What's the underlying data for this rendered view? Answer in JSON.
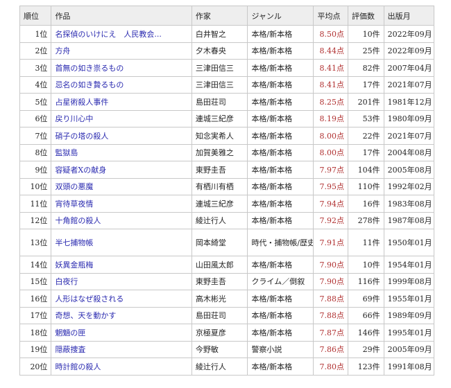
{
  "headers": {
    "rank": "順位",
    "title": "作品",
    "author": "作家",
    "genre": "ジャンル",
    "score": "平均点",
    "count": "評価数",
    "published": "出版月"
  },
  "rows": [
    {
      "rank": "1位",
      "title": "名探偵のいけにえ　人民教会...",
      "author": "白井智之",
      "genre": "本格/新本格",
      "score": "8.50点",
      "count": "10件",
      "published": "2022年09月"
    },
    {
      "rank": "2位",
      "title": "方舟",
      "author": "夕木春央",
      "genre": "本格/新本格",
      "score": "8.44点",
      "count": "25件",
      "published": "2022年09月"
    },
    {
      "rank": "3位",
      "title": "首無の如き祟るもの",
      "author": "三津田信三",
      "genre": "本格/新本格",
      "score": "8.41点",
      "count": "82件",
      "published": "2007年04月"
    },
    {
      "rank": "4位",
      "title": "忌名の如き贄るもの",
      "author": "三津田信三",
      "genre": "本格/新本格",
      "score": "8.41点",
      "count": "17件",
      "published": "2021年07月"
    },
    {
      "rank": "5位",
      "title": "占星術殺人事件",
      "author": "島田荘司",
      "genre": "本格/新本格",
      "score": "8.25点",
      "count": "201件",
      "published": "1981年12月"
    },
    {
      "rank": "6位",
      "title": "戻り川心中",
      "author": "連城三紀彦",
      "genre": "本格/新本格",
      "score": "8.19点",
      "count": "53件",
      "published": "1980年09月"
    },
    {
      "rank": "7位",
      "title": "硝子の塔の殺人",
      "author": "知念実希人",
      "genre": "本格/新本格",
      "score": "8.00点",
      "count": "22件",
      "published": "2021年07月"
    },
    {
      "rank": "8位",
      "title": "監獄島",
      "author": "加賀美雅之",
      "genre": "本格/新本格",
      "score": "8.00点",
      "count": "17件",
      "published": "2004年08月"
    },
    {
      "rank": "9位",
      "title": "容疑者Xの献身",
      "author": "東野圭吾",
      "genre": "本格/新本格",
      "score": "7.97点",
      "count": "104件",
      "published": "2005年08月"
    },
    {
      "rank": "10位",
      "title": "双頭の悪魔",
      "author": "有栖川有栖",
      "genre": "本格/新本格",
      "score": "7.95点",
      "count": "110件",
      "published": "1992年02月"
    },
    {
      "rank": "11位",
      "title": "宵待草夜情",
      "author": "連城三紀彦",
      "genre": "本格/新本格",
      "score": "7.94点",
      "count": "16件",
      "published": "1983年08月"
    },
    {
      "rank": "12位",
      "title": "十角館の殺人",
      "author": "綾辻行人",
      "genre": "本格/新本格",
      "score": "7.92点",
      "count": "278件",
      "published": "1987年08月"
    },
    {
      "rank": "13位",
      "title": "半七捕物帳",
      "author": "岡本綺堂",
      "genre": "時代・捕物帳/歴史ミステリ",
      "score": "7.91点",
      "count": "11件",
      "published": "1950年01月"
    },
    {
      "rank": "14位",
      "title": "妖異金瓶梅",
      "author": "山田風太郎",
      "genre": "本格/新本格",
      "score": "7.90点",
      "count": "10件",
      "published": "1954年01月"
    },
    {
      "rank": "15位",
      "title": "白夜行",
      "author": "東野圭吾",
      "genre": "クライム／倒叙",
      "score": "7.90点",
      "count": "116件",
      "published": "1999年08月"
    },
    {
      "rank": "16位",
      "title": "人形はなぜ殺される",
      "author": "高木彬光",
      "genre": "本格/新本格",
      "score": "7.88点",
      "count": "69件",
      "published": "1955年01月"
    },
    {
      "rank": "17位",
      "title": "奇想、天を動かす",
      "author": "島田荘司",
      "genre": "本格/新本格",
      "score": "7.88点",
      "count": "66件",
      "published": "1989年09月"
    },
    {
      "rank": "18位",
      "title": "魍魎の匣",
      "author": "京極夏彦",
      "genre": "本格/新本格",
      "score": "7.87点",
      "count": "146件",
      "published": "1995年01月"
    },
    {
      "rank": "19位",
      "title": "隠蔽捜査",
      "author": "今野敏",
      "genre": "警察小説",
      "score": "7.86点",
      "count": "29件",
      "published": "2005年09月"
    },
    {
      "rank": "20位",
      "title": "時計館の殺人",
      "author": "綾辻行人",
      "genre": "本格/新本格",
      "score": "7.80点",
      "count": "123件",
      "published": "1991年08月"
    }
  ]
}
